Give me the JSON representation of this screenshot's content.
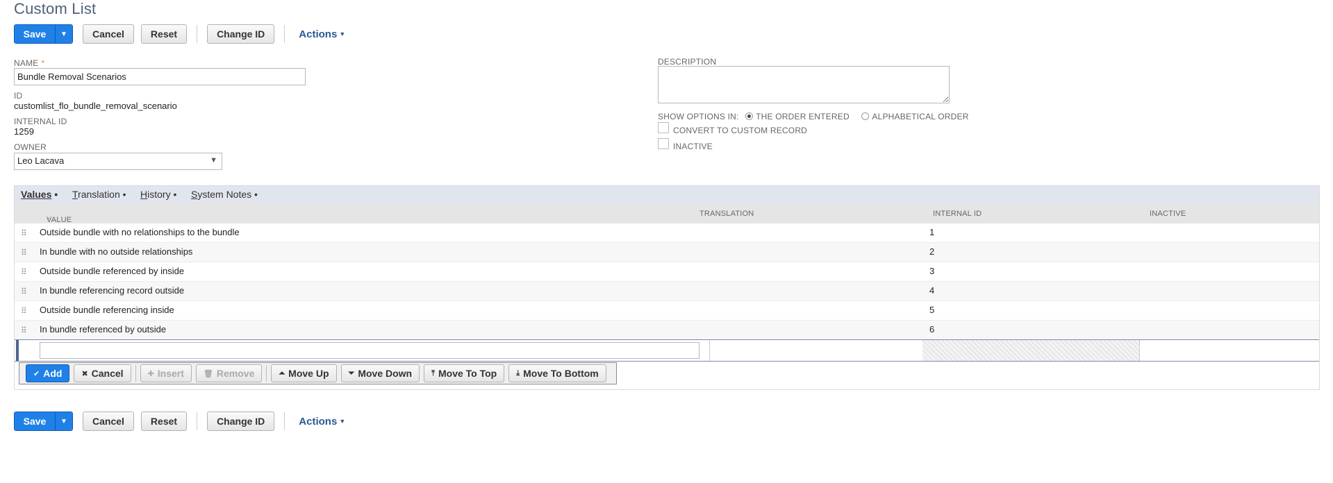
{
  "page": {
    "title": "Custom List"
  },
  "toolbar": {
    "save_label": "Save",
    "save_dropdown_icon": "▼",
    "cancel_label": "Cancel",
    "reset_label": "Reset",
    "change_id_label": "Change ID",
    "actions_label": "Actions"
  },
  "form": {
    "name_label": "NAME",
    "name_required": "*",
    "name_value": "Bundle Removal Scenarios",
    "id_label": "ID",
    "id_value": "customlist_flo_bundle_removal_scenario",
    "internal_id_label": "INTERNAL ID",
    "internal_id_value": "1259",
    "owner_label": "OWNER",
    "owner_value": "Leo Lacava",
    "description_label": "DESCRIPTION",
    "show_options_label": "SHOW OPTIONS IN:",
    "option_order_entered": "THE ORDER ENTERED",
    "option_alphabetical": "ALPHABETICAL ORDER",
    "convert_label": "CONVERT TO CUSTOM RECORD",
    "inactive_label": "INACTIVE"
  },
  "subtabs": [
    {
      "label": "Values",
      "u": "V",
      "rest": "alues",
      "active": true
    },
    {
      "label": "Translation",
      "u": "T",
      "rest": "ranslation",
      "active": false
    },
    {
      "label": "History",
      "u": "H",
      "rest": "istory",
      "active": false
    },
    {
      "label": "System Notes",
      "u": "S",
      "rest": "ystem Notes",
      "active": false
    }
  ],
  "table": {
    "columns": {
      "value": "VALUE",
      "value_required": "*",
      "translation": "TRANSLATION",
      "internal_id": "INTERNAL ID",
      "inactive": "INACTIVE"
    },
    "rows": [
      {
        "value": "Outside bundle with no relationships to the bundle",
        "internal_id": "1"
      },
      {
        "value": "In bundle with no outside relationships",
        "internal_id": "2"
      },
      {
        "value": "Outside bundle referenced by inside",
        "internal_id": "3"
      },
      {
        "value": "In bundle referencing record outside",
        "internal_id": "4"
      },
      {
        "value": "Outside bundle referencing inside",
        "internal_id": "5"
      },
      {
        "value": "In bundle referenced by outside",
        "internal_id": "6"
      }
    ]
  },
  "machine_buttons": {
    "add": "Add",
    "cancel": "Cancel",
    "insert": "Insert",
    "remove": "Remove",
    "move_up": "Move Up",
    "move_down": "Move Down",
    "move_to_top": "Move To Top",
    "move_to_bottom": "Move To Bottom"
  },
  "colors": {
    "primary": "#1f81e8",
    "title": "#4d5f79",
    "link": "#2a5a91",
    "required": "#e88a2e"
  }
}
